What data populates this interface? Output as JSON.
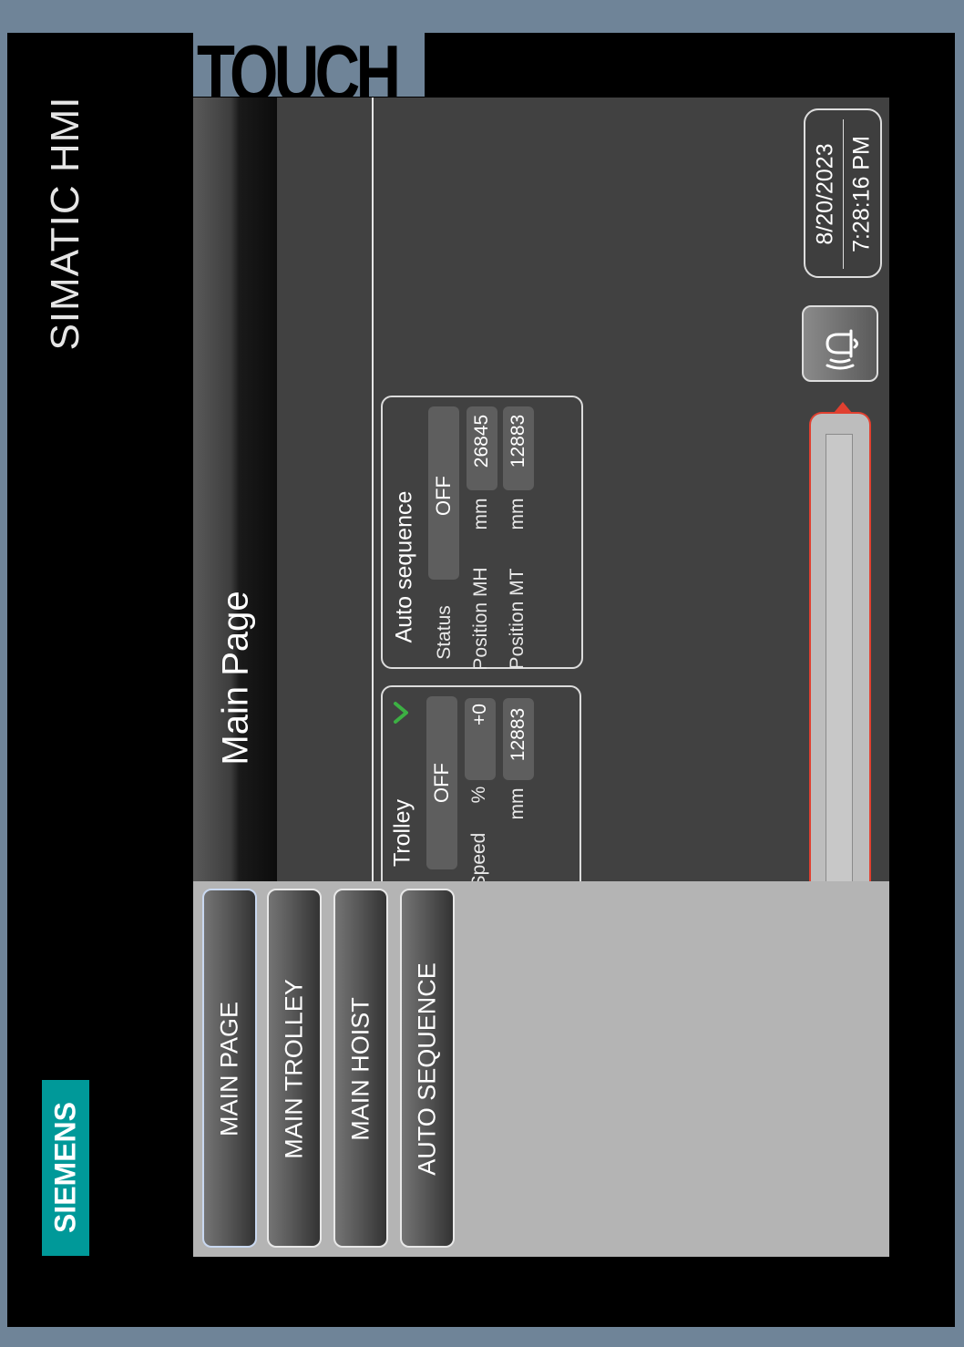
{
  "device": {
    "brand": "SIEMENS",
    "model": "SIMATIC HMI",
    "tab_label": "TOUCH"
  },
  "screen": {
    "title": "Main Page"
  },
  "trolley": {
    "title": "Trolley",
    "status_value": "OFF",
    "speed_label": "Speed",
    "speed_unit": "%",
    "speed_value": "+0",
    "position_unit": "mm",
    "position_value": "12883"
  },
  "auto_sequence": {
    "title": "Auto sequence",
    "status_label": "Status",
    "status_value": "OFF",
    "position_mh_label": "Position MH",
    "position_mh_unit": "mm",
    "position_mh_value": "26845",
    "position_mt_label": "Position MT",
    "position_mt_unit": "mm",
    "position_mt_value": "12883"
  },
  "datetime": {
    "date": "8/20/2023",
    "time": "7:28:16 PM"
  },
  "nav": {
    "main_page": "MAIN PAGE",
    "main_trolley": "MAIN TROLLEY",
    "main_hoist": "MAIN HOIST",
    "auto_sequence": "AUTO SEQUENCE"
  },
  "icons": {
    "alarm": "alarm-bell-icon",
    "check": "check-icon"
  },
  "colors": {
    "accent_teal": "#009999",
    "check_green": "#3cb043",
    "bar_outline": "#e04030"
  }
}
